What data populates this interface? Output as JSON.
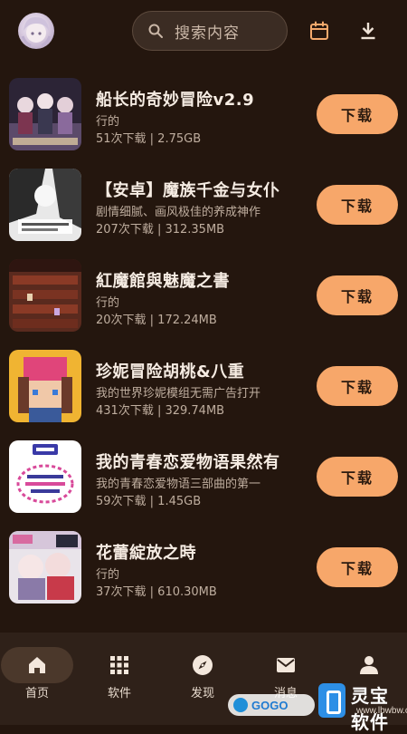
{
  "header": {
    "avatar_icon": "avatar-image",
    "search": {
      "placeholder": "搜索内容",
      "icon": "search-icon"
    },
    "calendar_icon": "calendar-icon",
    "download_icon": "download-icon"
  },
  "items": [
    {
      "title": "船长的奇妙冒险v2.9",
      "desc": "行的",
      "meta": "51次下载 | 2.75GB",
      "button": "下载"
    },
    {
      "title": "【安卓】魔族千金与女仆",
      "desc": "剧情细腻、画风极佳的养成神作",
      "meta": "207次下载 | 312.35MB",
      "button": "下载"
    },
    {
      "title": "紅魔館與魅魔之書",
      "desc": "行的",
      "meta": "20次下载 | 172.24MB",
      "button": "下载"
    },
    {
      "title": "珍妮冒险胡桃&八重",
      "desc": "我的世界珍妮模组无需广告打开",
      "meta": "431次下载 | 329.74MB",
      "button": "下载"
    },
    {
      "title": "我的青春恋爱物语果然有",
      "desc": "我的青春恋爱物语三部曲的第一",
      "meta": "59次下载 | 1.45GB",
      "button": "下载"
    },
    {
      "title": "花蕾綻放之時",
      "desc": "行的",
      "meta": "37次下载 | 610.30MB",
      "button": "下载"
    }
  ],
  "nav": {
    "home": "首页",
    "software": "软件",
    "discover": "发现",
    "messages": "消息",
    "profile": ""
  },
  "watermark": {
    "gogo": "GOGO",
    "name": "灵宝软件",
    "url": "www.lbwbw.com"
  },
  "colors": {
    "background": "#24160e",
    "button": "#f7a76a",
    "nav_background": "#2f2119"
  }
}
